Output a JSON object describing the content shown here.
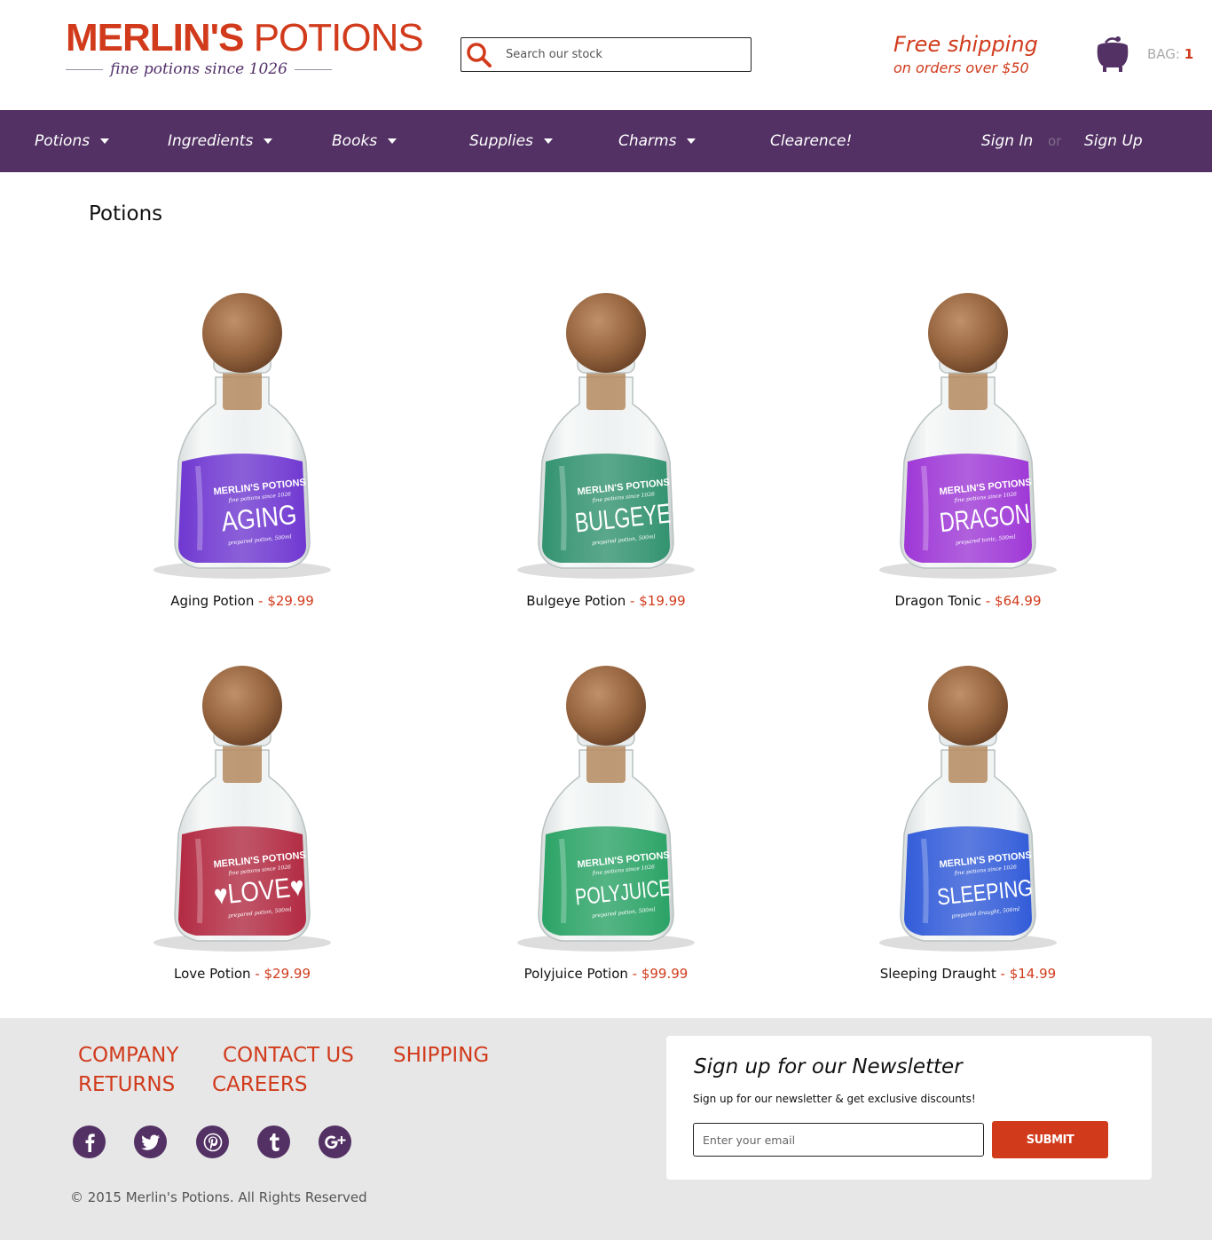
{
  "header": {
    "logo_bold": "MERLIN'S",
    "logo_light": " POTIONS",
    "logo_tagline": "fine potions since 1026",
    "search_placeholder": "Search our stock",
    "shipping_line1": "Free shipping",
    "shipping_line2": "on orders over $50",
    "bag_label": "BAG: ",
    "bag_count": "1"
  },
  "nav": {
    "items": [
      {
        "label": "Potions",
        "dropdown": true
      },
      {
        "label": "Ingredients",
        "dropdown": true
      },
      {
        "label": "Books",
        "dropdown": true
      },
      {
        "label": "Supplies",
        "dropdown": true
      },
      {
        "label": "Charms",
        "dropdown": true
      },
      {
        "label": "Clearence!",
        "dropdown": false
      }
    ],
    "sign_in": "Sign In",
    "or": "or",
    "sign_up": "Sign Up"
  },
  "main": {
    "title": "Potions",
    "products": [
      {
        "name": "Aging Potion",
        "sep": " - ",
        "price": "$29.99",
        "label_word": "AGING",
        "label_top": "MERLIN'S POTIONS",
        "label_sub": "fine potions since 1026",
        "label_foot": "prepared potion, 500ml",
        "liquid": "#6a2fd0"
      },
      {
        "name": "Bulgeye Potion",
        "sep": " - ",
        "price": "$19.99",
        "label_word": "BULGEYE",
        "label_top": "MERLIN'S POTIONS",
        "label_sub": "fine potions since 1026",
        "label_foot": "prepared potion, 500ml",
        "liquid": "#2a8f6a"
      },
      {
        "name": "Dragon Tonic",
        "sep": " - ",
        "price": "$64.99",
        "label_word": "DRAGON",
        "label_top": "MERLIN'S POTIONS",
        "label_sub": "fine potions since 1026",
        "label_foot": "prepared tonic, 500ml",
        "liquid": "#9b2fd6"
      },
      {
        "name": "Love Potion",
        "sep": " - ",
        "price": "$29.99",
        "label_word": "♥LOVE♥",
        "label_top": "MERLIN'S POTIONS",
        "label_sub": "fine potions since 1026",
        "label_foot": "prepared potion, 500ml",
        "liquid": "#b0213a"
      },
      {
        "name": "Polyjuice Potion",
        "sep": " - ",
        "price": "$99.99",
        "label_word": "POLYJUICE",
        "label_top": "MERLIN'S POTIONS",
        "label_sub": "fine potions since 1026",
        "label_foot": "prepared potion, 500ml",
        "liquid": "#22a060"
      },
      {
        "name": "Sleeping Draught",
        "sep": " - ",
        "price": "$14.99",
        "label_word": "SLEEPING",
        "label_top": "MERLIN'S POTIONS",
        "label_sub": "fine potions since 1026",
        "label_foot": "prepared draught, 500ml",
        "liquid": "#2a55d8"
      }
    ]
  },
  "footer": {
    "links": [
      "COMPANY",
      "CONTACT US",
      "SHIPPING",
      "RETURNS",
      "CAREERS"
    ],
    "social": [
      "facebook-icon",
      "twitter-icon",
      "pinterest-icon",
      "tumblr-icon",
      "google-plus-icon"
    ],
    "copyright": "© 2015 Merlin's Potions. All Rights Reserved",
    "newsletter_title": "Sign up for our Newsletter",
    "newsletter_sub": "Sign up for our newsletter & get exclusive discounts!",
    "email_placeholder": "Enter your email",
    "submit_label": "SUBMIT"
  },
  "colors": {
    "brand_red": "#d13b1c",
    "brand_purple": "#533164",
    "footer_bg": "#e7e7e7"
  }
}
